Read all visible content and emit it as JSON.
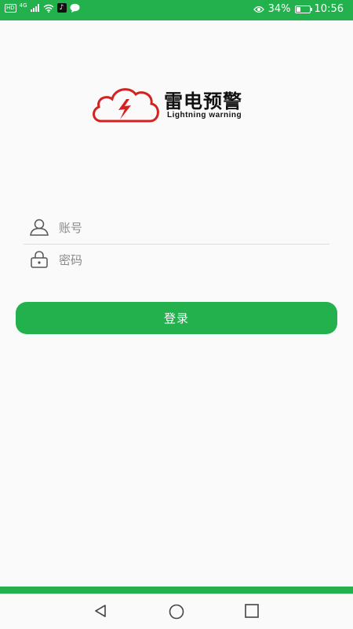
{
  "status_bar": {
    "network_badge": "HD",
    "network_type": "4G",
    "tiktok_glyph": "♪",
    "eye_icon": "eye-icon",
    "battery_percent": "34%",
    "battery_level": 0.34,
    "time": "10:56"
  },
  "app": {
    "title": "雷电预警",
    "subtitle": "Lightning warning",
    "brand_color": "#22b14c",
    "logo_color": "#d42222"
  },
  "form": {
    "account_placeholder": "账号",
    "password_placeholder": "密码",
    "login_label": "登录"
  },
  "nav": {
    "back": "back-icon",
    "home": "home-icon",
    "recents": "recents-icon"
  }
}
